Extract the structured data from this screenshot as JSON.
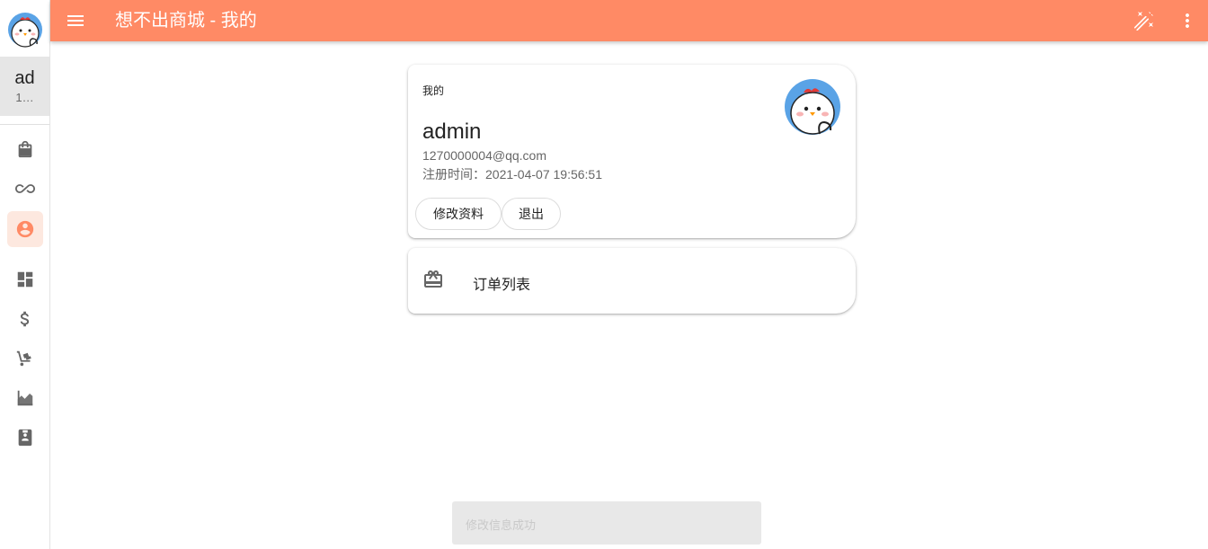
{
  "app": {
    "title": "想不出商城 - 我的"
  },
  "rail": {
    "user_short": "ad",
    "user_sub": "1…",
    "items": [
      {
        "name": "shopping-bag-icon",
        "active": false
      },
      {
        "name": "infinity-icon",
        "active": false
      },
      {
        "name": "account-circle-icon",
        "active": true
      },
      {
        "name": "dashboard-icon",
        "active": false
      },
      {
        "name": "dollar-icon",
        "active": false
      },
      {
        "name": "hand-truck-icon",
        "active": false
      },
      {
        "name": "area-chart-icon",
        "active": false
      },
      {
        "name": "contact-book-icon",
        "active": false
      }
    ]
  },
  "profile": {
    "overline": "我的",
    "name": "admin",
    "email": "1270000004@qq.com",
    "reg_time": "注册时间：2021-04-07 19:56:51",
    "edit_label": "修改资料",
    "logout_label": "退出"
  },
  "orders": {
    "label": "订单列表"
  },
  "snackbar": {
    "message": "修改信息成功"
  },
  "colors": {
    "primary": "#ff8a65",
    "active_bg": "#fde8df",
    "avatar_blue": "#5aa3e6"
  }
}
